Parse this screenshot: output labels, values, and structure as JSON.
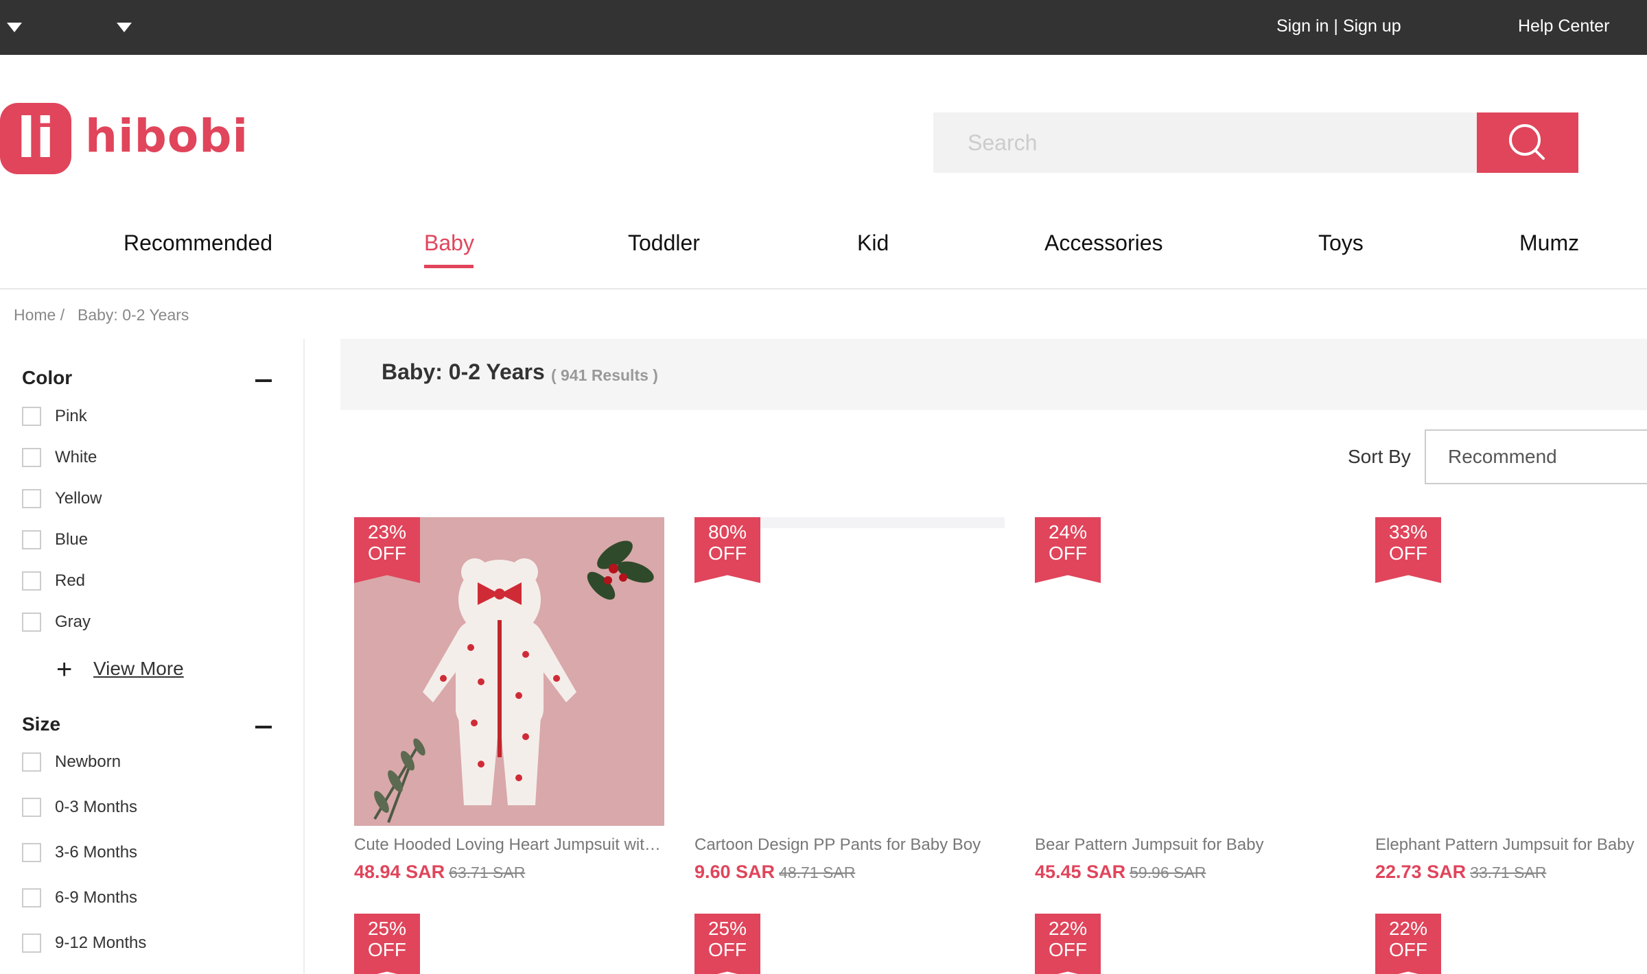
{
  "topbar": {
    "dropdown_icons": [
      "caret-down-icon",
      "caret-down-icon"
    ],
    "sign_in": "Sign in | Sign up",
    "help": "Help Center"
  },
  "brand": {
    "logo_mark": "li",
    "name": "hibobi",
    "color": "#e0455b"
  },
  "search": {
    "placeholder": "Search",
    "icon": "search-icon"
  },
  "nav": [
    {
      "label": "Recommended",
      "active": false
    },
    {
      "label": "Baby",
      "active": true
    },
    {
      "label": "Toddler",
      "active": false
    },
    {
      "label": "Kid",
      "active": false
    },
    {
      "label": "Accessories",
      "active": false
    },
    {
      "label": "Toys",
      "active": false
    },
    {
      "label": "Mumz",
      "active": false
    }
  ],
  "breadcrumb": {
    "home": "Home /",
    "current": "Baby: 0-2 Years"
  },
  "filters": {
    "color": {
      "title": "Color",
      "options": [
        "Pink",
        "White",
        "Yellow",
        "Blue",
        "Red",
        "Gray"
      ],
      "view_more": "View More"
    },
    "size": {
      "title": "Size",
      "options": [
        "Newborn",
        "0-3 Months",
        "3-6 Months",
        "6-9 Months",
        "9-12 Months"
      ]
    }
  },
  "results": {
    "title": "Baby: 0-2 Years",
    "count": "( 941 Results )"
  },
  "sort": {
    "label": "Sort By",
    "value": "Recommend"
  },
  "products": [
    {
      "discount": "23%",
      "off": "OFF",
      "name": "Cute Hooded Loving Heart Jumpsuit with Bow for Baby",
      "price": "48.94 SAR",
      "original": "63.71 SAR"
    },
    {
      "discount": "80%",
      "off": "OFF",
      "name": "Cartoon Design PP Pants for Baby Boy",
      "price": "9.60 SAR",
      "original": "48.71 SAR"
    },
    {
      "discount": "24%",
      "off": "OFF",
      "name": "Bear Pattern Jumpsuit for Baby",
      "price": "45.45 SAR",
      "original": "59.96 SAR"
    },
    {
      "discount": "33%",
      "off": "OFF",
      "name": "Elephant Pattern Jumpsuit for Baby",
      "price": "22.73 SAR",
      "original": "33.71 SAR"
    }
  ],
  "products_row2": [
    {
      "discount": "25%",
      "off": "OFF"
    },
    {
      "discount": "25%",
      "off": "OFF"
    },
    {
      "discount": "22%",
      "off": "OFF"
    },
    {
      "discount": "22%",
      "off": "OFF"
    }
  ]
}
